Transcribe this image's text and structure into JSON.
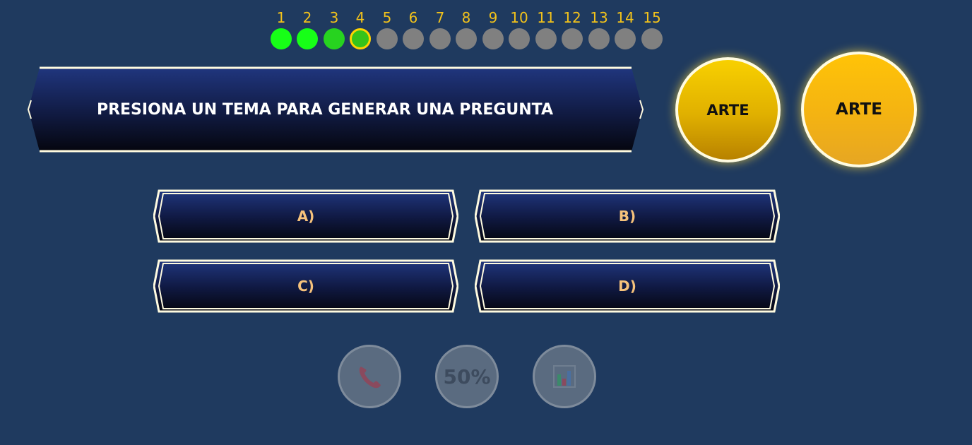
{
  "progress": {
    "steps": [
      "1",
      "2",
      "3",
      "4",
      "5",
      "6",
      "7",
      "8",
      "9",
      "10",
      "11",
      "12",
      "13",
      "14",
      "15"
    ],
    "current_step": 4,
    "completed_steps": 3
  },
  "question": {
    "text": "PRESIONA UN TEMA PARA GENERAR UNA PREGUNTA"
  },
  "topics": [
    {
      "label": "ARTE"
    },
    {
      "label": "ARTE"
    }
  ],
  "answers": {
    "a": "A)",
    "b": "B)",
    "c": "C)",
    "d": "D)"
  },
  "lifelines": {
    "phone_icon": "phone-icon",
    "fifty_label": "50%",
    "audience_icon": "bar-chart-icon"
  },
  "colors": {
    "background": "#1f3a5f",
    "ladder_number": "#f2c21b",
    "completed": "#17ff17",
    "pending": "#808080",
    "answer_text": "#f6c27b",
    "border": "#fffbe0"
  }
}
